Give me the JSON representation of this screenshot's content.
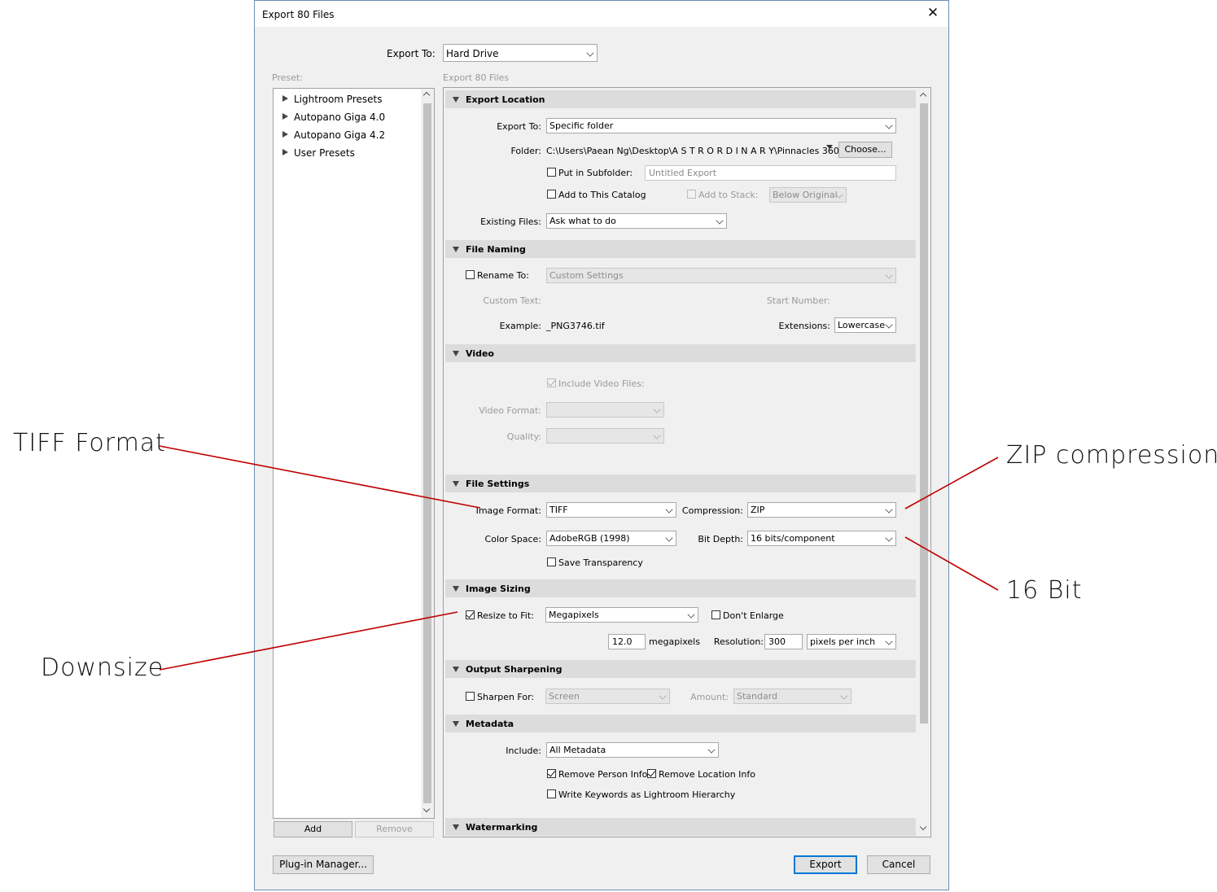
{
  "dialog": {
    "title": "Export 80 Files",
    "export_to_label": "Export To:",
    "export_to_value": "Hard Drive",
    "preset_label": "Preset:",
    "section_caption": "Export 80 Files"
  },
  "presets": {
    "items": [
      {
        "label": "Lightroom Presets"
      },
      {
        "label": "Autopano Giga 4.0"
      },
      {
        "label": "Autopano Giga 4.2"
      },
      {
        "label": "User Presets"
      }
    ],
    "add_label": "Add",
    "remove_label": "Remove"
  },
  "export_location": {
    "title": "Export Location",
    "export_to_label": "Export To:",
    "export_to_value": "Specific folder",
    "folder_label": "Folder:",
    "folder_path": "C:\\Users\\Paean Ng\\Desktop\\A S T R O R D I N A R Y\\Pinnacles 360",
    "choose_label": "Choose...",
    "subfolder_label": "Put in Subfolder:",
    "subfolder_checked": false,
    "subfolder_placeholder": "Untitled Export",
    "add_catalog_label": "Add to This Catalog",
    "add_catalog_checked": false,
    "add_stack_label": "Add to Stack:",
    "stack_value": "Below Original",
    "existing_files_label": "Existing Files:",
    "existing_files_value": "Ask what to do"
  },
  "file_naming": {
    "title": "File Naming",
    "rename_label": "Rename To:",
    "rename_checked": false,
    "rename_value": "Custom Settings",
    "custom_text_label": "Custom Text:",
    "start_number_label": "Start Number:",
    "example_label": "Example:",
    "example_value": "_PNG3746.tif",
    "extensions_label": "Extensions:",
    "extensions_value": "Lowercase"
  },
  "video": {
    "title": "Video",
    "include_label": "Include Video Files:",
    "include_checked": true,
    "format_label": "Video Format:",
    "quality_label": "Quality:"
  },
  "file_settings": {
    "title": "File Settings",
    "image_format_label": "Image Format:",
    "image_format_value": "TIFF",
    "compression_label": "Compression:",
    "compression_value": "ZIP",
    "color_space_label": "Color Space:",
    "color_space_value": "AdobeRGB (1998)",
    "bit_depth_label": "Bit Depth:",
    "bit_depth_value": "16 bits/component",
    "save_transparency_label": "Save Transparency",
    "save_transparency_checked": false
  },
  "image_sizing": {
    "title": "Image Sizing",
    "resize_label": "Resize to Fit:",
    "resize_checked": true,
    "resize_value": "Megapixels",
    "dont_enlarge_label": "Don't Enlarge",
    "dont_enlarge_checked": false,
    "megapixels_value": "12.0",
    "megapixels_unit": "megapixels",
    "resolution_label": "Resolution:",
    "resolution_value": "300",
    "resolution_unit": "pixels per inch"
  },
  "output_sharpening": {
    "title": "Output Sharpening",
    "sharpen_label": "Sharpen For:",
    "sharpen_checked": false,
    "sharpen_value": "Screen",
    "amount_label": "Amount:",
    "amount_value": "Standard"
  },
  "metadata": {
    "title": "Metadata",
    "include_label": "Include:",
    "include_value": "All Metadata",
    "remove_person_label": "Remove Person Info",
    "remove_person_checked": true,
    "remove_location_label": "Remove Location Info",
    "remove_location_checked": true,
    "keywords_label": "Write Keywords as Lightroom Hierarchy",
    "keywords_checked": false
  },
  "watermarking": {
    "title": "Watermarking"
  },
  "footer": {
    "plugin_manager_label": "Plug-in Manager...",
    "export_label": "Export",
    "cancel_label": "Cancel"
  },
  "annotations": {
    "tiff": "TIFF Format",
    "zip": "ZIP compression",
    "bit": "16 Bit",
    "downsize": "Downsize"
  },
  "colors": {
    "annotation_line": "#c00000",
    "default_button_border": "#0078d7",
    "section_header": "#dcdcdc"
  }
}
